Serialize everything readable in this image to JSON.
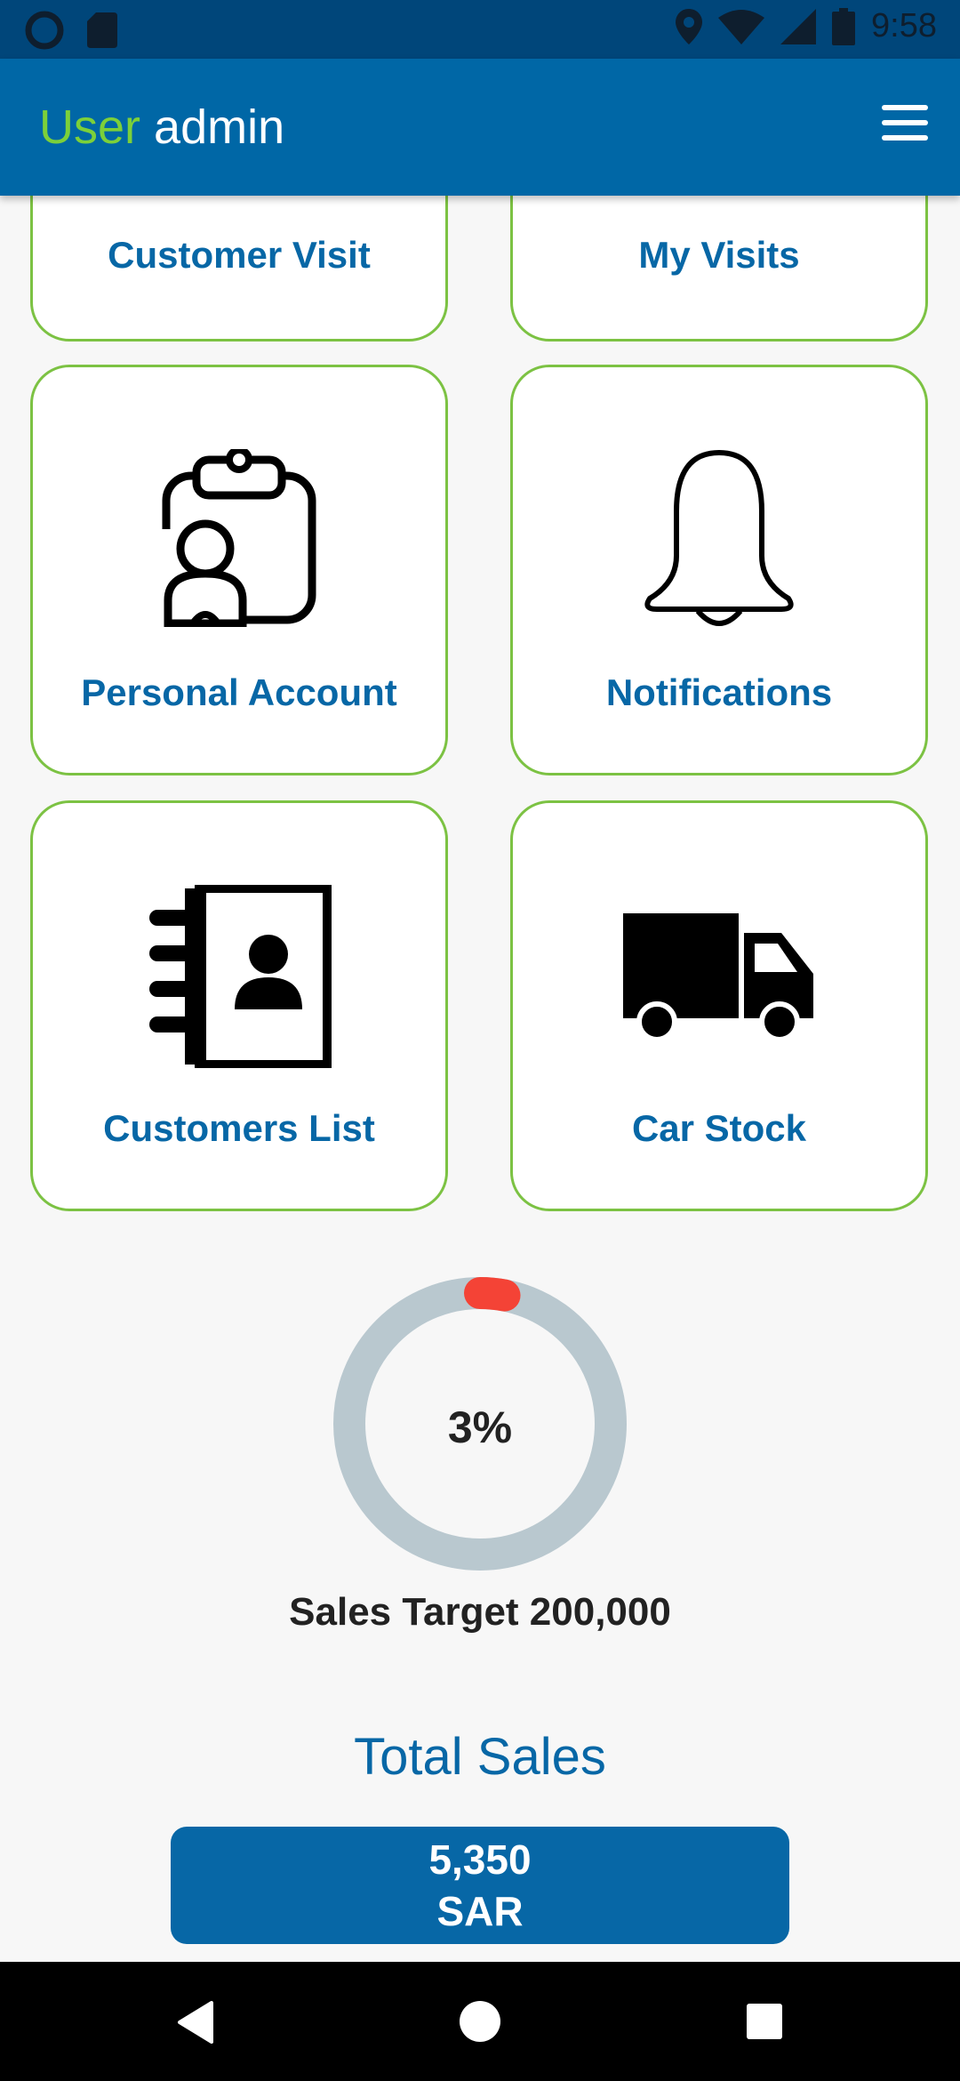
{
  "status_bar": {
    "time": "9:58"
  },
  "app_bar": {
    "user_label": "User",
    "username": "admin"
  },
  "tiles": [
    {
      "label": "Customer Visit",
      "icon": "customer-visit-icon"
    },
    {
      "label": "My Visits",
      "icon": "my-visits-icon"
    },
    {
      "label": "Personal Account",
      "icon": "clipboard-user-icon"
    },
    {
      "label": "Notifications",
      "icon": "bell-icon"
    },
    {
      "label": "Customers List",
      "icon": "contact-book-icon"
    },
    {
      "label": "Car Stock",
      "icon": "truck-icon"
    }
  ],
  "sales_progress": {
    "percent_text": "3%",
    "percent": 3,
    "target_label": "Sales Target 200,000"
  },
  "total_sales": {
    "title": "Total Sales",
    "amount": "5,350",
    "currency": "SAR"
  },
  "colors": {
    "primary": "#0767a6",
    "accent_green": "#7cc243",
    "progress_red": "#f44336",
    "track_gray": "#b9c8cf"
  }
}
